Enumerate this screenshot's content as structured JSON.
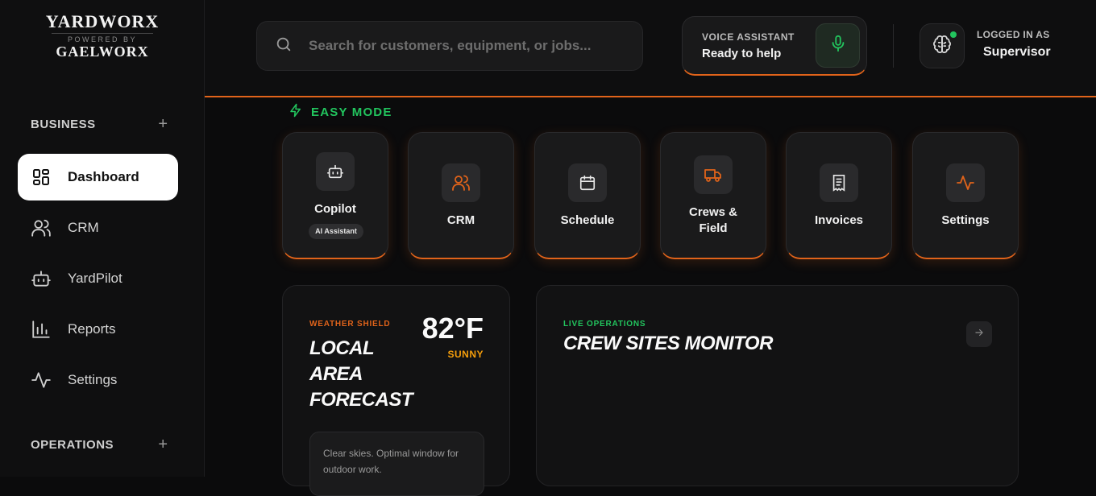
{
  "brand": {
    "name": "YARDWORX",
    "powered_by": "POWERED BY",
    "parent": "GAELWORX"
  },
  "sidebar": {
    "sections": [
      {
        "title": "BUSINESS",
        "action": "+"
      },
      {
        "title": "OPERATIONS",
        "action": "+"
      }
    ],
    "items": [
      {
        "label": "Dashboard",
        "icon": "dashboard-grid-icon",
        "active": true
      },
      {
        "label": "CRM",
        "icon": "users-icon",
        "active": false
      },
      {
        "label": "YardPilot",
        "icon": "bot-icon",
        "active": false
      },
      {
        "label": "Reports",
        "icon": "bar-chart-icon",
        "active": false
      },
      {
        "label": "Settings",
        "icon": "activity-icon",
        "active": false
      }
    ]
  },
  "header": {
    "search": {
      "placeholder": "Search for customers, equipment, or jobs...",
      "value": ""
    },
    "voice": {
      "title": "VOICE ASSISTANT",
      "status": "Ready to help"
    },
    "user": {
      "caption": "LOGGED IN AS",
      "role": "Supervisor",
      "online": true
    }
  },
  "easy_mode": {
    "label": "EASY MODE"
  },
  "tiles": [
    {
      "label": "Copilot",
      "badge": "AI Assistant",
      "icon": "bot-icon"
    },
    {
      "label": "CRM",
      "icon": "users-icon"
    },
    {
      "label": "Schedule",
      "icon": "calendar-icon"
    },
    {
      "label_line1": "Crews &",
      "label_line2": "Field",
      "icon": "truck-icon"
    },
    {
      "label": "Invoices",
      "icon": "receipt-icon"
    },
    {
      "label": "Settings",
      "icon": "activity-icon"
    }
  ],
  "weather": {
    "tag": "WEATHER SHIELD",
    "title_l1": "LOCAL",
    "title_l2": "AREA",
    "title_l3": "FORECAST",
    "temp": "82°F",
    "condition": "SUNNY",
    "note": "Clear skies. Optimal window for outdoor work."
  },
  "crew_monitor": {
    "tag": "LIVE OPERATIONS",
    "title": "CREW SITES MONITOR"
  },
  "colors": {
    "accent": "#e0631a",
    "success": "#22c55e",
    "warning": "#f59e0b",
    "background": "#0b0b0c"
  }
}
